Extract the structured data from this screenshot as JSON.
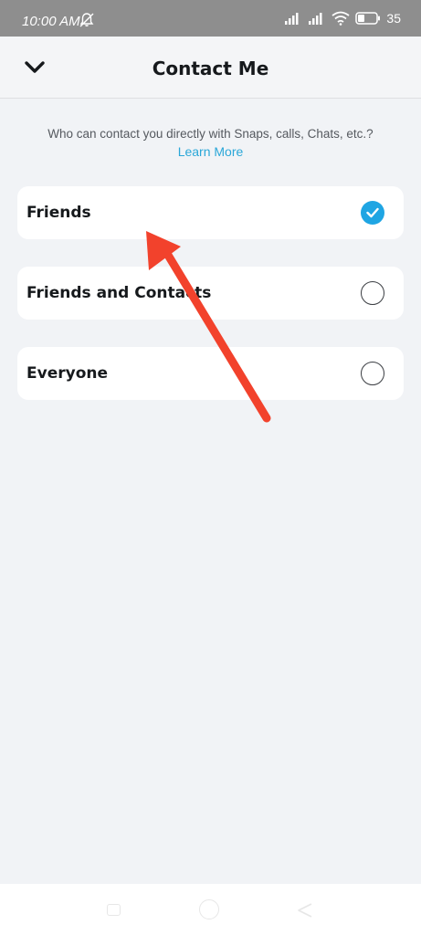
{
  "status_bar": {
    "time": "10:00 AM",
    "battery": "35"
  },
  "header": {
    "title": "Contact Me"
  },
  "description": "Who can contact you directly with Snaps, calls, Chats, etc.?",
  "learn_more": "Learn More",
  "options": [
    {
      "label": "Friends",
      "selected": true
    },
    {
      "label": "Friends and Contacts",
      "selected": false
    },
    {
      "label": "Everyone",
      "selected": false
    }
  ],
  "colors": {
    "accent": "#1fa5e3",
    "link": "#2aa7d8",
    "annotation_arrow": "#f2422c"
  }
}
